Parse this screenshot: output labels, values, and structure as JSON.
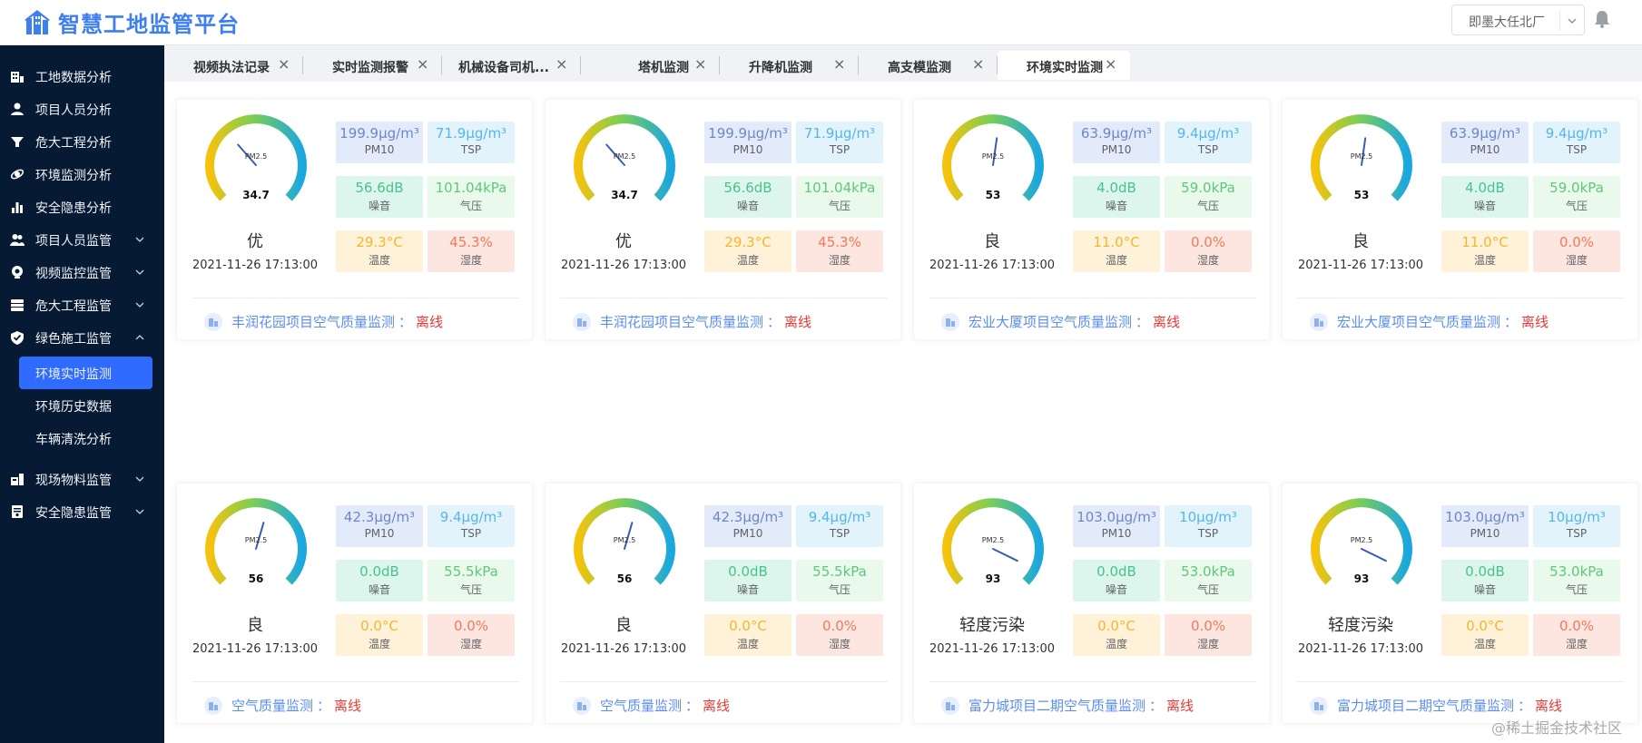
{
  "app": {
    "title": "智慧工地监管平台"
  },
  "header": {
    "project_select": "即墨大任北厂"
  },
  "sidebar": {
    "items": [
      {
        "label": "工地数据分析",
        "icon": "building-chart-icon"
      },
      {
        "label": "项目人员分析",
        "icon": "person-icon"
      },
      {
        "label": "危大工程分析",
        "icon": "funnel-icon"
      },
      {
        "label": "环境监测分析",
        "icon": "orbit-icon"
      },
      {
        "label": "安全隐患分析",
        "icon": "bar-chart-icon"
      },
      {
        "label": "项目人员监管",
        "icon": "people-icon",
        "expandable": true
      },
      {
        "label": "视频监控监管",
        "icon": "camera-icon",
        "expandable": true
      },
      {
        "label": "危大工程监管",
        "icon": "stack-icon",
        "expandable": true
      },
      {
        "label": "绿色施工监管",
        "icon": "shield-check-icon",
        "expandable": true,
        "expanded": true
      },
      {
        "label": "现场物料监管",
        "icon": "materials-icon",
        "expandable": true
      },
      {
        "label": "安全隐患监管",
        "icon": "document-icon",
        "expandable": true
      }
    ],
    "subitems": [
      {
        "label": "环境实时监测",
        "active": true
      },
      {
        "label": "环境历史数据",
        "active": false
      },
      {
        "label": "车辆清洗分析",
        "active": false
      }
    ]
  },
  "tabs": [
    {
      "label": "视频执法记录"
    },
    {
      "label": "实时监测报警"
    },
    {
      "label": "机械设备司机..."
    },
    {
      "label": "塔机监测"
    },
    {
      "label": "升降机监测"
    },
    {
      "label": "高支模监测"
    },
    {
      "label": "环境实时监测",
      "active": true
    }
  ],
  "gauge_label": "PM2.5",
  "footer_colon": "：",
  "metric_names": {
    "pm10": "PM10",
    "tsp": "TSP",
    "noise": "噪音",
    "pressure": "气压",
    "temperature": "温度",
    "humidity": "湿度"
  },
  "cards": [
    {
      "pm25": "34.7",
      "pm25_num": 34.7,
      "grade": "优",
      "time": "2021-11-26 17:13:00",
      "pm10": "199.9μg/m³",
      "tsp": "71.9μg/m³",
      "noise": "56.6dB",
      "pressure": "101.04kPa",
      "temperature": "29.3°C",
      "humidity": "45.3%",
      "name": "丰润花园项目空气质量监测",
      "status": "离线"
    },
    {
      "pm25": "34.7",
      "pm25_num": 34.7,
      "grade": "优",
      "time": "2021-11-26 17:13:00",
      "pm10": "199.9μg/m³",
      "tsp": "71.9μg/m³",
      "noise": "56.6dB",
      "pressure": "101.04kPa",
      "temperature": "29.3°C",
      "humidity": "45.3%",
      "name": "丰润花园项目空气质量监测",
      "status": "离线"
    },
    {
      "pm25": "53",
      "pm25_num": 53,
      "grade": "良",
      "time": "2021-11-26 17:13:00",
      "pm10": "63.9μg/m³",
      "tsp": "9.4μg/m³",
      "noise": "4.0dB",
      "pressure": "59.0kPa",
      "temperature": "11.0°C",
      "humidity": "0.0%",
      "name": "宏业大厦项目空气质量监测",
      "status": "离线"
    },
    {
      "pm25": "53",
      "pm25_num": 53,
      "grade": "良",
      "time": "2021-11-26 17:13:00",
      "pm10": "63.9μg/m³",
      "tsp": "9.4μg/m³",
      "noise": "4.0dB",
      "pressure": "59.0kPa",
      "temperature": "11.0°C",
      "humidity": "0.0%",
      "name": "宏业大厦项目空气质量监测",
      "status": "离线"
    },
    {
      "pm25": "56",
      "pm25_num": 56,
      "grade": "良",
      "time": "2021-11-26 17:13:00",
      "pm10": "42.3μg/m³",
      "tsp": "9.4μg/m³",
      "noise": "0.0dB",
      "pressure": "55.5kPa",
      "temperature": "0.0°C",
      "humidity": "0.0%",
      "name": "空气质量监测",
      "status": "离线"
    },
    {
      "pm25": "56",
      "pm25_num": 56,
      "grade": "良",
      "time": "2021-11-26 17:13:00",
      "pm10": "42.3μg/m³",
      "tsp": "9.4μg/m³",
      "noise": "0.0dB",
      "pressure": "55.5kPa",
      "temperature": "0.0°C",
      "humidity": "0.0%",
      "name": "空气质量监测",
      "status": "离线"
    },
    {
      "pm25": "93",
      "pm25_num": 93,
      "grade": "轻度污染",
      "time": "2021-11-26 17:13:00",
      "pm10": "103.0μg/m³",
      "tsp": "10μg/m³",
      "noise": "0.0dB",
      "pressure": "53.0kPa",
      "temperature": "0.0°C",
      "humidity": "0.0%",
      "name": "富力城项目二期空气质量监测",
      "status": "离线"
    },
    {
      "pm25": "93",
      "pm25_num": 93,
      "grade": "轻度污染",
      "time": "2021-11-26 17:13:00",
      "pm10": "103.0μg/m³",
      "tsp": "10μg/m³",
      "noise": "0.0dB",
      "pressure": "53.0kPa",
      "temperature": "0.0°C",
      "humidity": "0.0%",
      "name": "富力城项目二期空气质量监测",
      "status": "离线"
    }
  ],
  "watermark": "@稀土掘金技术社区"
}
